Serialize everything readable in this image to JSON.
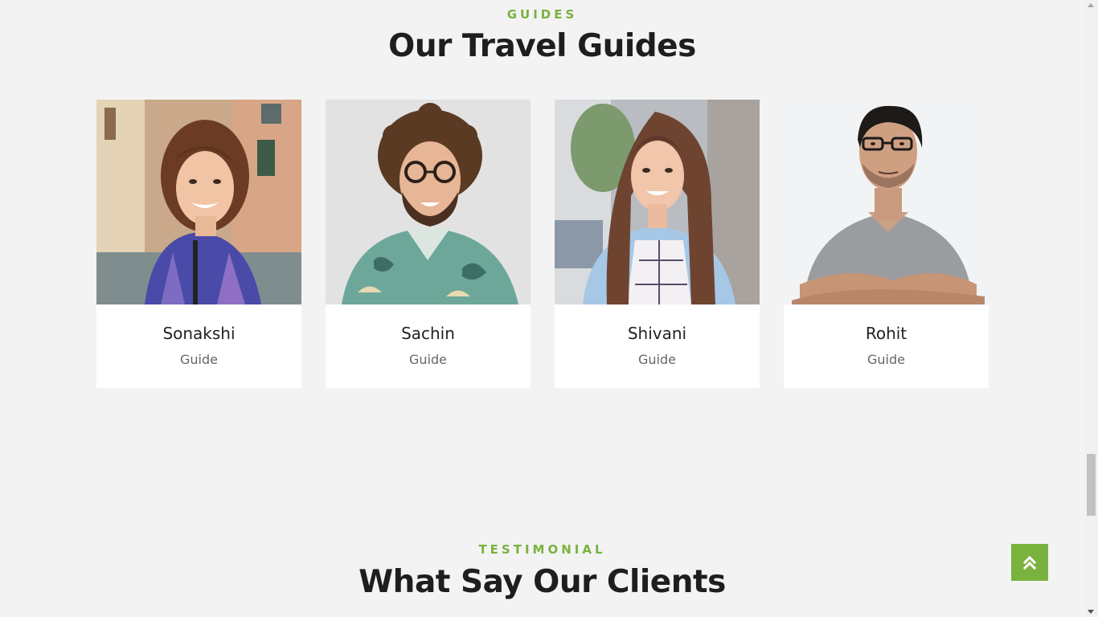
{
  "guides_section": {
    "eyebrow": "GUIDES",
    "title": "Our Travel Guides",
    "guides": [
      {
        "name": "Sonakshi",
        "role": "Guide"
      },
      {
        "name": "Sachin",
        "role": "Guide"
      },
      {
        "name": "Shivani",
        "role": "Guide"
      },
      {
        "name": "Rohit",
        "role": "Guide"
      }
    ]
  },
  "testimonial_section": {
    "eyebrow": "TESTIMONIAL",
    "title": "What Say Our Clients"
  },
  "colors": {
    "accent": "#7ab23e",
    "background": "#f3f3f3",
    "card": "#ffffff",
    "heading": "#1e1e1e"
  },
  "icons": {
    "back_to_top": "double-chevron-up-icon"
  }
}
